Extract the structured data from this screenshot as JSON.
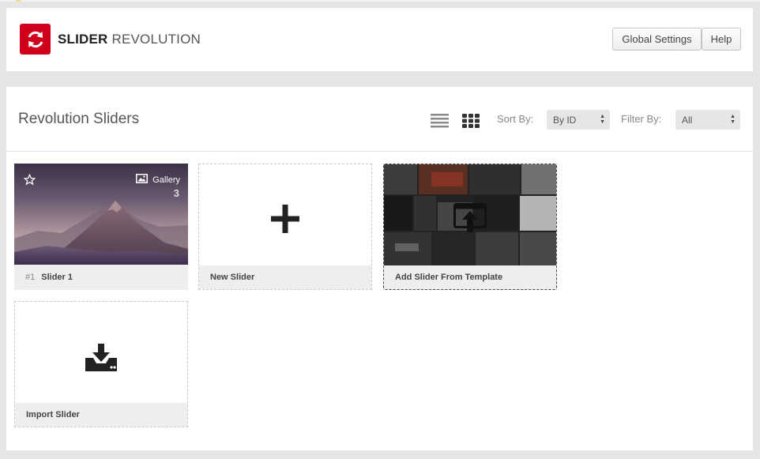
{
  "header": {
    "logo_bold": "SLIDER",
    "logo_light": "REVOLUTION",
    "global_settings_label": "Global Settings",
    "help_label": "Help"
  },
  "main": {
    "title": "Revolution Sliders",
    "sort_label": "Sort By:",
    "sort_value": "By ID",
    "filter_label": "Filter By:",
    "filter_value": "All"
  },
  "sliders": [
    {
      "number": "#1",
      "name": "Slider 1",
      "type": "Gallery",
      "count": "3"
    }
  ],
  "cards": {
    "new_slider": "New Slider",
    "add_from_template": "Add Slider From Template",
    "import_slider": "Import Slider"
  },
  "icons": {
    "logo": "refresh-icon",
    "view_list": "list-view-icon",
    "view_grid": "grid-view-icon",
    "star": "star-icon",
    "gallery": "image-icon",
    "add": "plus-icon",
    "template": "upload-window-icon",
    "import": "download-tray-icon"
  },
  "colors": {
    "brand": "#d0001a",
    "panel": "#ffffff",
    "background": "#e5e5e5",
    "card_footer": "#eeeeef"
  }
}
